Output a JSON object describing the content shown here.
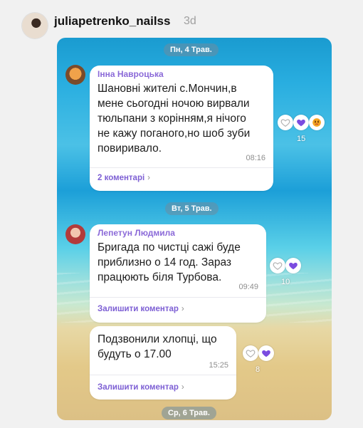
{
  "post": {
    "username": "juliapetrenko_nailss",
    "time_ago": "3d"
  },
  "dates": {
    "mon": "Пн, 4 Трав.",
    "tue": "Вт, 5 Трав.",
    "wed": "Ср, 6 Трав."
  },
  "messages": [
    {
      "author": "Інна Навроцька",
      "lines": [
        "Шановні жителі с.Мончин,в",
        "мене сьогодні ночою вирвали",
        "тюльпани з корінням,я нічого",
        "не кажу поганого,но шоб зуби",
        "повиривало."
      ],
      "time": "08:16",
      "comments": "2 коментарі",
      "reaction_count": "15"
    },
    {
      "author": "Лепетун Людмила",
      "lines": [
        "Бригада по чистці сажі буде",
        "приблизно о 14 год. Зараз",
        "працюють біля Турбова."
      ],
      "time": "09:49",
      "comments": "Залишити коментар",
      "reaction_count": "10"
    },
    {
      "author": "",
      "lines": [
        "Подзвонили хлопці, що",
        "будуть о 17.00"
      ],
      "time": "15:25",
      "comments": "Залишити коментар",
      "reaction_count": "8"
    }
  ],
  "icons": {
    "heart_empty": "heart-outline-icon",
    "heart_filled": "heart-filled-icon",
    "angry": "angry-emoji-icon",
    "chevron": "chevron-right-icon"
  },
  "colors": {
    "accent": "#7d5fd4",
    "heart": "#7b4ce0"
  }
}
